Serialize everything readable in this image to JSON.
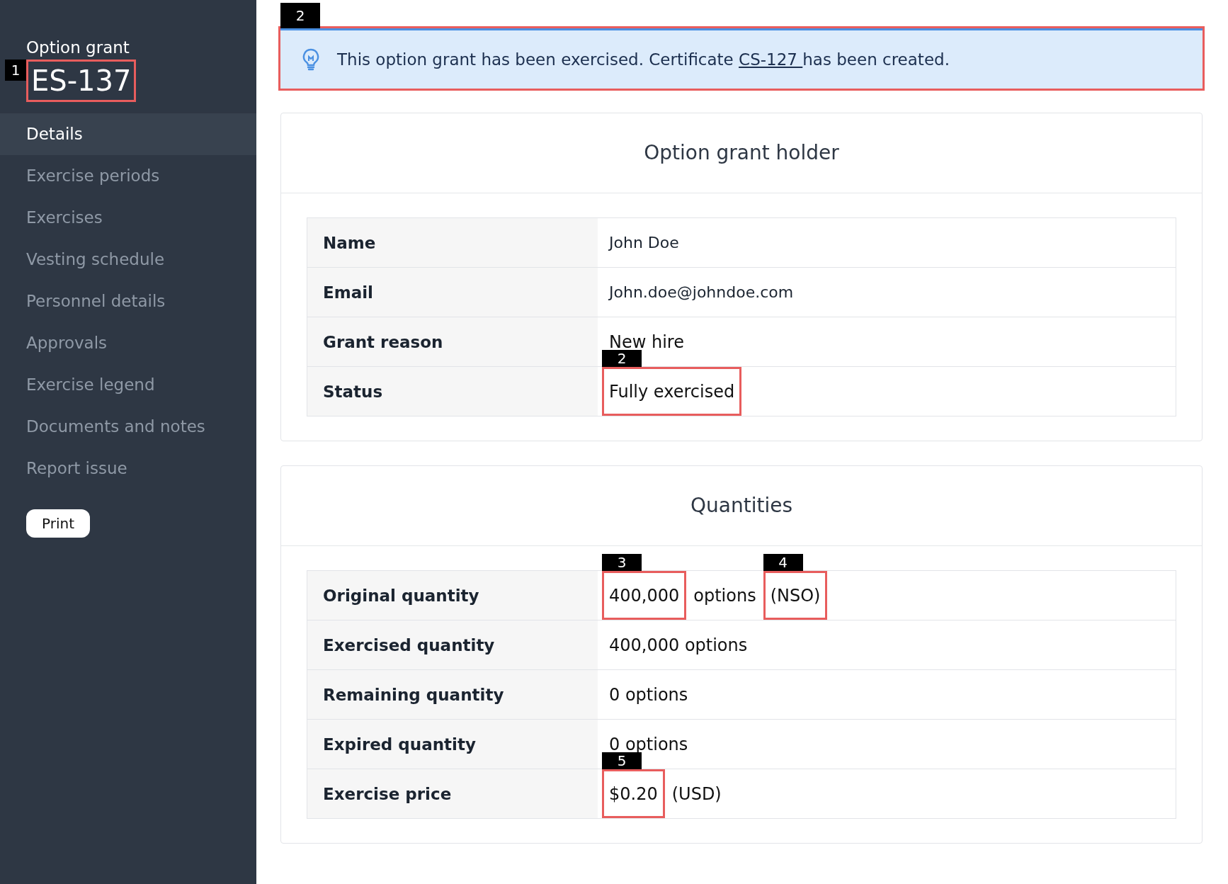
{
  "sidebar": {
    "subtitle": "Option grant",
    "title": "ES-137",
    "title_marker": "1",
    "items": [
      {
        "label": "Details",
        "selected": true
      },
      {
        "label": "Exercise periods",
        "selected": false
      },
      {
        "label": "Exercises",
        "selected": false
      },
      {
        "label": "Vesting schedule",
        "selected": false
      },
      {
        "label": "Personnel details",
        "selected": false
      },
      {
        "label": "Approvals",
        "selected": false
      },
      {
        "label": "Exercise legend",
        "selected": false
      },
      {
        "label": "Documents and notes",
        "selected": false
      },
      {
        "label": "Report issue",
        "selected": false
      }
    ],
    "print_button": "Print"
  },
  "banner": {
    "marker": "2",
    "before": "This option grant has been exercised. Certificate",
    "link": "CS-127 ",
    "after": "has been created."
  },
  "cards": [
    {
      "title": "Option grant holder",
      "rows": [
        {
          "label": "Name",
          "kind": "light",
          "parts": [
            {
              "text": "John Doe"
            }
          ]
        },
        {
          "label": "Email",
          "kind": "light",
          "parts": [
            {
              "text": "John.doe@johndoe.com"
            }
          ]
        },
        {
          "label": "Grant reason",
          "kind": "plain",
          "parts": [
            {
              "text": "New hire"
            }
          ]
        },
        {
          "label": "Status",
          "kind": "plain",
          "parts": [
            {
              "text": "Fully exercised",
              "marker": "2"
            }
          ]
        }
      ]
    },
    {
      "title": "Quantities",
      "rows": [
        {
          "label": "Original quantity",
          "kind": "plain",
          "parts": [
            {
              "text": "400,000",
              "marker": "3"
            },
            {
              "text": "options"
            },
            {
              "text": "(NSO)",
              "marker": "4"
            }
          ]
        },
        {
          "label": "Exercised quantity",
          "kind": "plain",
          "parts": [
            {
              "text": "400,000 options"
            }
          ]
        },
        {
          "label": "Remaining quantity",
          "kind": "plain",
          "parts": [
            {
              "text": "0 options"
            }
          ]
        },
        {
          "label": "Expired quantity",
          "kind": "plain",
          "parts": [
            {
              "text": "0 options"
            }
          ]
        },
        {
          "label": "Exercise price",
          "kind": "plain",
          "parts": [
            {
              "text": "$0.20",
              "marker": "5"
            },
            {
              "text": "(USD)"
            }
          ]
        }
      ]
    }
  ]
}
